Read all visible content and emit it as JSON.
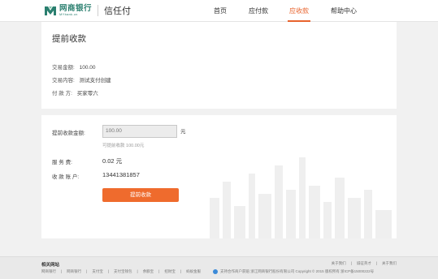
{
  "header": {
    "logo_cn": "网商银行",
    "logo_en": "MYbank.cn",
    "product": "信任付",
    "brand_color": "#2a7f6f",
    "nav": [
      {
        "label": "首页",
        "active": false
      },
      {
        "label": "应付款",
        "active": false
      },
      {
        "label": "应收款",
        "active": true
      },
      {
        "label": "帮助中心",
        "active": false
      }
    ],
    "accent_color": "#e8632d"
  },
  "page": {
    "title": "提前收款"
  },
  "info": {
    "amount_label": "交易金额:",
    "amount_value": "100.00",
    "content_label": "交易内容:",
    "content_value": "测试支付创建",
    "payer_label": "付 款 方:",
    "payer_value": "买家零六"
  },
  "form": {
    "amount_label": "提前收款金额:",
    "amount_value": "100.00",
    "unit": "元",
    "hint": "可提前收款 100.00元",
    "fee_label": "服 务 费:",
    "fee_value": "0.02 元",
    "account_label": "收 款 账 户:",
    "account_value": "13441381857",
    "submit_label": "提前收款",
    "button_color": "#ef6b2d"
  },
  "footer": {
    "title": "相关网站",
    "links": [
      "网商银行",
      "网商银行",
      "支付宝",
      "支付宝钱包",
      "余额宝",
      "招财宝",
      "蚂蚁金服"
    ],
    "right_links": [
      "关于我们",
      "诚征英才",
      "关于我们"
    ],
    "copyright": "支持合作商户获赔  浙江网商银行股份有限公司 Copyright © 2015 版权所有 浙ICP备15000222号"
  }
}
